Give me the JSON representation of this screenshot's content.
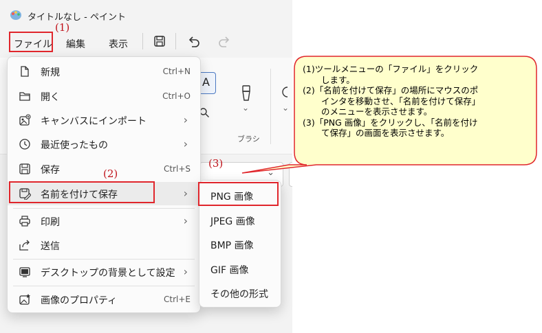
{
  "window": {
    "title": "タイトルなし - ペイント"
  },
  "menubar": {
    "file": "ファイル",
    "edit": "編集",
    "view": "表示"
  },
  "ribbon": {
    "brush_label": "ブラシ"
  },
  "file_menu": {
    "items": [
      {
        "label": "新規",
        "shortcut": "Ctrl+N"
      },
      {
        "label": "開く",
        "shortcut": "Ctrl+O"
      },
      {
        "label": "キャンバスにインポート",
        "chevron": "›"
      },
      {
        "label": "最近使ったもの",
        "chevron": "›"
      },
      {
        "label": "保存",
        "shortcut": "Ctrl+S"
      },
      {
        "label": "名前を付けて保存",
        "chevron": "›"
      },
      {
        "label": "印刷",
        "chevron": "›"
      },
      {
        "label": "送信"
      },
      {
        "label": "デスクトップの背景として設定",
        "chevron": "›"
      },
      {
        "label": "画像のプロパティ",
        "shortcut": "Ctrl+E"
      }
    ]
  },
  "save_as_submenu": {
    "items": [
      {
        "label": "PNG 画像"
      },
      {
        "label": "JPEG 画像"
      },
      {
        "label": "BMP 画像"
      },
      {
        "label": "GIF 画像"
      },
      {
        "label": "その他の形式"
      }
    ]
  },
  "annotations": {
    "n1": "(1)",
    "n2": "(2)",
    "n3": "(3)"
  },
  "callout": {
    "line1a": "(1)ツールメニューの「ファイル」をクリック",
    "line1b": "します。",
    "line2a": "(2)「名前を付けて保存」の場所にマウスのポ",
    "line2b": "インタを移動させ、「名前を付けて保存」",
    "line2c": "のメニューを表示させます。",
    "line3a": "(3)「PNG 画像」をクリックし、「名前を付け",
    "line3b": "て保存」の画面を表示させます。"
  },
  "colors": {
    "annotation_red": "#e0252b",
    "callout_fill": "#ffffcc"
  }
}
